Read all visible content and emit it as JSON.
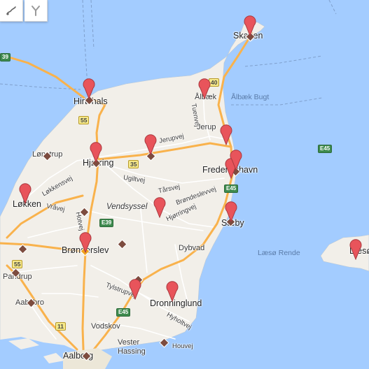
{
  "toolbar": {
    "draw_tool_icon": "hand-draw-icon",
    "route_tool_icon": "route-fork-icon"
  },
  "colors": {
    "sea": "#a3ccff",
    "land": "#f2efe9",
    "road_major": "#f9b24c",
    "road_minor": "#ffffff",
    "pin": "#e8545b",
    "diamond": "#7d4c3f",
    "diamond_selected": "#f0a31f"
  },
  "places": [
    {
      "label": "Skagen",
      "style": "major"
    },
    {
      "label": "Hirtshals",
      "style": "major"
    },
    {
      "label": "Ålbæk",
      "style": ""
    },
    {
      "label": "Ålbæk Bugt",
      "style": "water"
    },
    {
      "label": "Tuenvej",
      "style": ""
    },
    {
      "label": "Jerup",
      "style": ""
    },
    {
      "label": "Jerupvej",
      "style": ""
    },
    {
      "label": "Lønstrup",
      "style": ""
    },
    {
      "label": "Hjørring",
      "style": "major"
    },
    {
      "label": "Frederikshavn",
      "style": "major"
    },
    {
      "label": "Ugiltvej",
      "style": ""
    },
    {
      "label": "Tårsvej",
      "style": ""
    },
    {
      "label": "Brøndeslevvej",
      "style": ""
    },
    {
      "label": "Løkkensvej",
      "style": ""
    },
    {
      "label": "Løkken",
      "style": "major"
    },
    {
      "label": "Vendsyssel",
      "style": "region"
    },
    {
      "label": "Hjørringvej",
      "style": ""
    },
    {
      "label": "Sæby",
      "style": "major"
    },
    {
      "label": "Vråvej",
      "style": ""
    },
    {
      "label": "Hotvej",
      "style": ""
    },
    {
      "label": "Brønderslev",
      "style": "major"
    },
    {
      "label": "Dybvad",
      "style": ""
    },
    {
      "label": "Læsø Rende",
      "style": "water"
    },
    {
      "label": "Læsø",
      "style": "major"
    },
    {
      "label": "Pandrup",
      "style": ""
    },
    {
      "label": "Tylstrupvej",
      "style": ""
    },
    {
      "label": "Dronninglund",
      "style": "major"
    },
    {
      "label": "Aabybro",
      "style": ""
    },
    {
      "label": "Hyholtvej",
      "style": ""
    },
    {
      "label": "Vodskov",
      "style": ""
    },
    {
      "label": "Vester Hassing",
      "style": ""
    },
    {
      "label": "Houvej",
      "style": ""
    },
    {
      "label": "Aalborg",
      "style": "major"
    }
  ],
  "road_shields": [
    {
      "label": "55",
      "color": "yellow"
    },
    {
      "label": "40",
      "color": "yellow"
    },
    {
      "label": "35",
      "color": "yellow"
    },
    {
      "label": "E39",
      "color": "green"
    },
    {
      "label": "E45",
      "color": "green"
    },
    {
      "label": "E45",
      "color": "green"
    },
    {
      "label": "E45",
      "color": "green"
    },
    {
      "label": "55",
      "color": "yellow"
    },
    {
      "label": "11",
      "color": "yellow"
    },
    {
      "label": "39",
      "color": "green"
    }
  ],
  "pins": [
    {
      "name": "skagen"
    },
    {
      "name": "hirtshals"
    },
    {
      "name": "albaek"
    },
    {
      "name": "jerup"
    },
    {
      "name": "hjorring"
    },
    {
      "name": "frederikshavn-1"
    },
    {
      "name": "frederikshavn-2"
    },
    {
      "name": "hjorringvej"
    },
    {
      "name": "lokken"
    },
    {
      "name": "saeby"
    },
    {
      "name": "bronderslev"
    },
    {
      "name": "laeso"
    },
    {
      "name": "tylstrup"
    },
    {
      "name": "dronninglund"
    }
  ],
  "markers": [
    {
      "name": "skagen",
      "selected": false
    },
    {
      "name": "hirtshals",
      "selected": false
    },
    {
      "name": "lonstrup",
      "selected": false
    },
    {
      "name": "hjorring",
      "selected": false
    },
    {
      "name": "jerupvej",
      "selected": false
    },
    {
      "name": "frederikshavn",
      "selected": false
    },
    {
      "name": "hotvej",
      "selected": false
    },
    {
      "name": "bronderslev",
      "selected": true
    },
    {
      "name": "bronderslev-east",
      "selected": false
    },
    {
      "name": "saeby",
      "selected": false
    },
    {
      "name": "pandrup-north",
      "selected": false
    },
    {
      "name": "pandrup",
      "selected": false
    },
    {
      "name": "tylstrup",
      "selected": false
    },
    {
      "name": "aabybro",
      "selected": false
    },
    {
      "name": "vester-hassing",
      "selected": false
    },
    {
      "name": "aalborg",
      "selected": false
    }
  ]
}
